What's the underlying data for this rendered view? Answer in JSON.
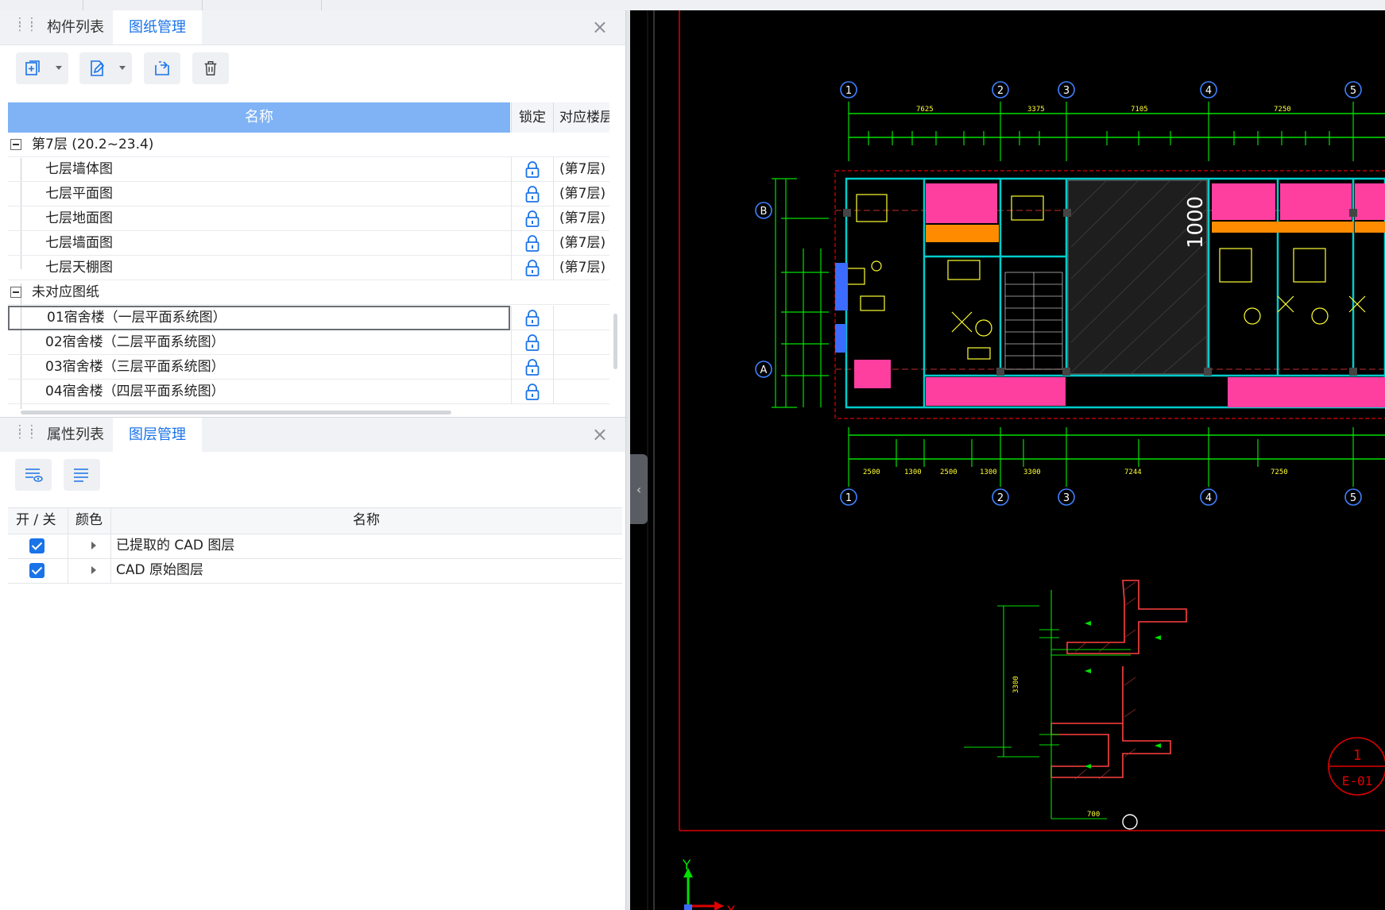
{
  "drawing_panel": {
    "tabs": [
      {
        "label": "构件列表"
      },
      {
        "label": "图纸管理"
      }
    ],
    "table": {
      "col_name": "名称",
      "col_lock": "锁定",
      "col_floor": "对应楼层"
    },
    "groups": [
      {
        "label": "第7层 (20.2~23.4)",
        "items": [
          {
            "name": "七层墙体图",
            "floor": "(第7层)"
          },
          {
            "name": "七层平面图",
            "floor": "(第7层)"
          },
          {
            "name": "七层地面图",
            "floor": "(第7层)"
          },
          {
            "name": "七层墙面图",
            "floor": "(第7层)"
          },
          {
            "name": "七层天棚图",
            "floor": "(第7层)"
          }
        ]
      },
      {
        "label": "未对应图纸",
        "items": [
          {
            "name": "01宿舍楼（一层平面系统图）",
            "floor": "",
            "selected": true
          },
          {
            "name": "02宿舍楼（二层平面系统图）",
            "floor": ""
          },
          {
            "name": "03宿舍楼（三层平面系统图）",
            "floor": ""
          },
          {
            "name": "04宿舍楼（四层平面系统图）",
            "floor": ""
          }
        ]
      }
    ]
  },
  "layer_panel": {
    "tabs": [
      {
        "label": "属性列表"
      },
      {
        "label": "图层管理"
      }
    ],
    "table": {
      "col_toggle": "开 / 关",
      "col_color": "颜色",
      "col_name": "名称"
    },
    "rows": [
      {
        "name": "已提取的 CAD 图层",
        "on": true
      },
      {
        "name": "CAD 原始图层",
        "on": true
      }
    ]
  },
  "cad": {
    "axis_top": [
      "1",
      "2",
      "3",
      "4",
      "5"
    ],
    "axis_side": [
      "B",
      "A"
    ],
    "dims_top_row1": [
      "7625",
      "3375",
      "7105",
      "7250"
    ],
    "dims_bottom_row2": [
      "2500",
      "1300",
      "2500",
      "1300",
      "3300",
      "7244",
      "7250"
    ],
    "big_label": "1000",
    "detail_bottom": "700",
    "detail_side": "3300",
    "section_mark_top": "1",
    "section_mark_bottom": "E-01",
    "ucs_y": "Y",
    "ucs_x": "X",
    "colors": {
      "green": "#00e000",
      "red": "#e00000",
      "magenta": "#ff3fa0",
      "yellow": "#ffff33",
      "cyan": "#00cccc",
      "orange": "#ff8c00",
      "blue": "#3b6cff"
    }
  }
}
